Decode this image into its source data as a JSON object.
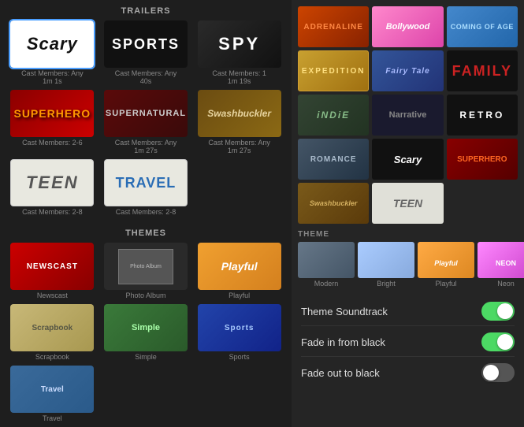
{
  "leftPanel": {
    "trailersHeader": "TRAILERS",
    "trailers": [
      {
        "id": "scary",
        "label": "Cast Members: Any",
        "sub": "1m 1s",
        "style": "scary",
        "text": "Scary"
      },
      {
        "id": "sports",
        "label": "Cast Members: Any",
        "sub": "40s",
        "style": "sports",
        "text": "SPORTS"
      },
      {
        "id": "spy",
        "label": "Cast Members: 1",
        "sub": "1m 19s",
        "style": "spy",
        "text": "SPY"
      },
      {
        "id": "superhero",
        "label": "Cast Members: 2-6",
        "sub": "",
        "style": "superhero",
        "text": "SUPERHERO"
      },
      {
        "id": "supernatural",
        "label": "Cast Members: Any",
        "sub": "1m 27s",
        "style": "supernatural",
        "text": "SUPERNATURAL"
      },
      {
        "id": "swashbuckler",
        "label": "Cast Members: Any",
        "sub": "1m 27s",
        "style": "swashbuckler",
        "text": "Swashbuckler"
      },
      {
        "id": "teen",
        "label": "Cast Members: 2-8",
        "sub": "",
        "style": "teen",
        "text": "TEEN"
      },
      {
        "id": "travel",
        "label": "Cast Members: 2-8",
        "sub": "",
        "style": "travel",
        "text": "TRAVEL"
      }
    ],
    "themesHeader": "THEMES",
    "themes": [
      {
        "id": "newscast",
        "label": "Newscast",
        "style": "newscast",
        "text": "NEWSCAST"
      },
      {
        "id": "photoalbum",
        "label": "Photo Album",
        "style": "photoalbum",
        "text": "Photo Album"
      },
      {
        "id": "playful",
        "label": "Playful",
        "style": "playful",
        "text": "Playful"
      },
      {
        "id": "scrapbook",
        "label": "Scrapbook",
        "style": "scrapbook",
        "text": "Scrapbook"
      },
      {
        "id": "simple",
        "label": "Simple",
        "style": "simple",
        "text": ""
      },
      {
        "id": "sports2",
        "label": "Sports",
        "style": "sports2",
        "text": ""
      },
      {
        "id": "travel2",
        "label": "Travel",
        "style": "travel2",
        "text": ""
      }
    ]
  },
  "rightPanel": {
    "trailerTypes": [
      {
        "id": "adrenaline",
        "label": "ADRENALINE",
        "style": "adrenaline"
      },
      {
        "id": "bollywood",
        "label": "Bollywood",
        "style": "bollywood"
      },
      {
        "id": "comingofage",
        "label": "Coming Of Age",
        "style": "comingofage"
      },
      {
        "id": "expedition",
        "label": "EXPEDITION",
        "style": "expedition"
      },
      {
        "id": "fairytale",
        "label": "Fairy Tale",
        "style": "fairytale"
      },
      {
        "id": "family",
        "label": "FAMILY",
        "style": "family"
      },
      {
        "id": "indie",
        "label": "iNDiE",
        "style": "indie"
      },
      {
        "id": "narrative",
        "label": "Narrative",
        "style": "narrative"
      },
      {
        "id": "retro",
        "label": "RETRO",
        "style": "retro"
      },
      {
        "id": "romance",
        "label": "ROMANCE",
        "style": "romance"
      },
      {
        "id": "scary2",
        "label": "Scary",
        "style": "scary2"
      },
      {
        "id": "superhero2",
        "label": "SUPERHERO",
        "style": "superhero2"
      },
      {
        "id": "swashbuckler2",
        "label": "Swashbuckler",
        "style": "swashbuckler2"
      },
      {
        "id": "teen2",
        "label": "TEEN",
        "style": "teen2"
      }
    ],
    "themeSectionLabel": "THEME",
    "themeOptions": [
      {
        "id": "modern",
        "label": "Modern",
        "style": "modern"
      },
      {
        "id": "bright",
        "label": "Bright",
        "style": "bright"
      },
      {
        "id": "playful",
        "label": "Playful",
        "style": "playful"
      },
      {
        "id": "neon",
        "label": "Neon",
        "style": "neon"
      }
    ],
    "toggles": [
      {
        "id": "soundtrack",
        "label": "Theme Soundtrack",
        "on": true
      },
      {
        "id": "fadein",
        "label": "Fade in from black",
        "on": true
      },
      {
        "id": "fadeout",
        "label": "Fade out to black",
        "on": false
      }
    ]
  }
}
